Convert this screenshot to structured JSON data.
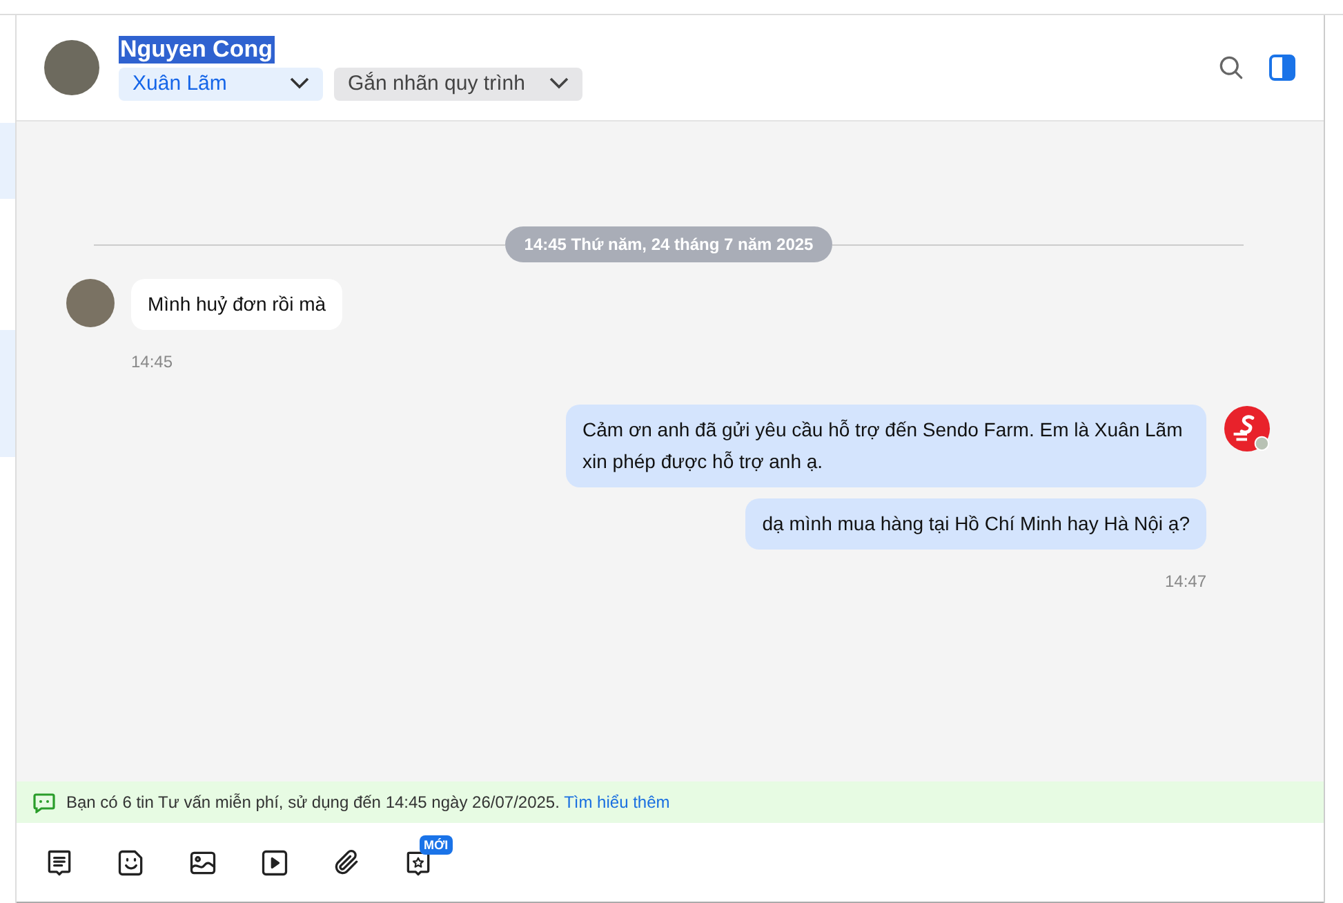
{
  "header": {
    "contact_name": "Nguyen Cong",
    "name_highlighted": true,
    "assignee": "Xuân Lãm",
    "label_dropdown": "Gắn nhãn quy trình"
  },
  "date_separator": "14:45 Thứ năm, 24 tháng 7 năm 2025",
  "messages": [
    {
      "kind": "incoming",
      "texts": [
        "Mình huỷ đơn rồi mà"
      ],
      "time": "14:45"
    },
    {
      "kind": "outgoing",
      "texts": [
        "Cảm ơn anh đã gửi yêu cầu hỗ trợ đến Sendo Farm. Em là Xuân Lãm xin phép được hỗ trợ anh ạ.",
        "dạ mình mua hàng tại Hồ Chí Minh hay Hà Nội ạ?"
      ],
      "time": "14:47"
    }
  ],
  "notice": {
    "text": "Bạn có 6 tin Tư vấn miễn phí, sử dụng đến 14:45 ngày 26/07/2025.",
    "link": "Tìm hiểu thêm"
  },
  "toolbar": {
    "new_badge": "MỚI"
  }
}
